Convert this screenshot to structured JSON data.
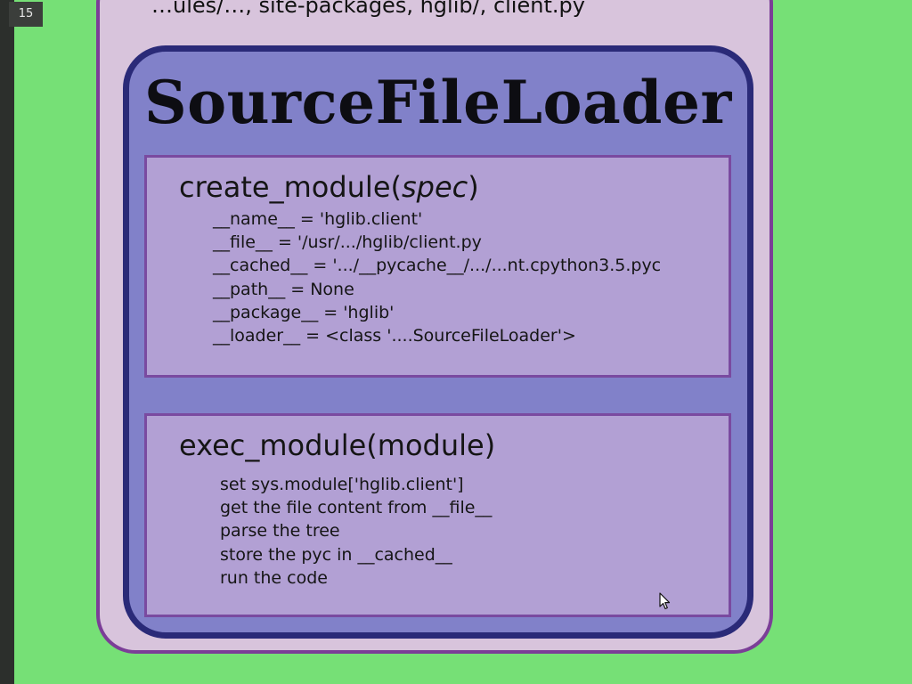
{
  "slide": {
    "number": "15"
  },
  "top_fragment": "…ules/…, site-packages, hglib/, client.py",
  "loader": {
    "title": "SourceFileLoader",
    "create_module": {
      "name": "create_module(",
      "arg": "spec",
      "close": ")",
      "lines": [
        "__name__ = 'hglib.client'",
        "__file__ = '/usr/.../hglib/client.py",
        "__cached__ = '.../__pycache__/.../...nt.cpython3.5.pyc",
        "__path__ = None",
        "__package__ = 'hglib'",
        "__loader__ = <class '....SourceFileLoader'>"
      ]
    },
    "exec_module": {
      "name": "exec_module(module)",
      "lines": [
        "set sys.module['hglib.client']",
        "get the file content from __file__",
        "parse the tree",
        "store the pyc in __cached__",
        "run the code"
      ]
    }
  },
  "colors": {
    "background": "#76e076",
    "outer_card": "#d8c4dc",
    "outer_border": "#7b3e97",
    "loader_frame": "#8181c9",
    "loader_border": "#2a2a78",
    "method_box": "#b2a0d4",
    "method_border": "#7a4aa0"
  },
  "cursor_icon": "mouse-pointer-icon"
}
